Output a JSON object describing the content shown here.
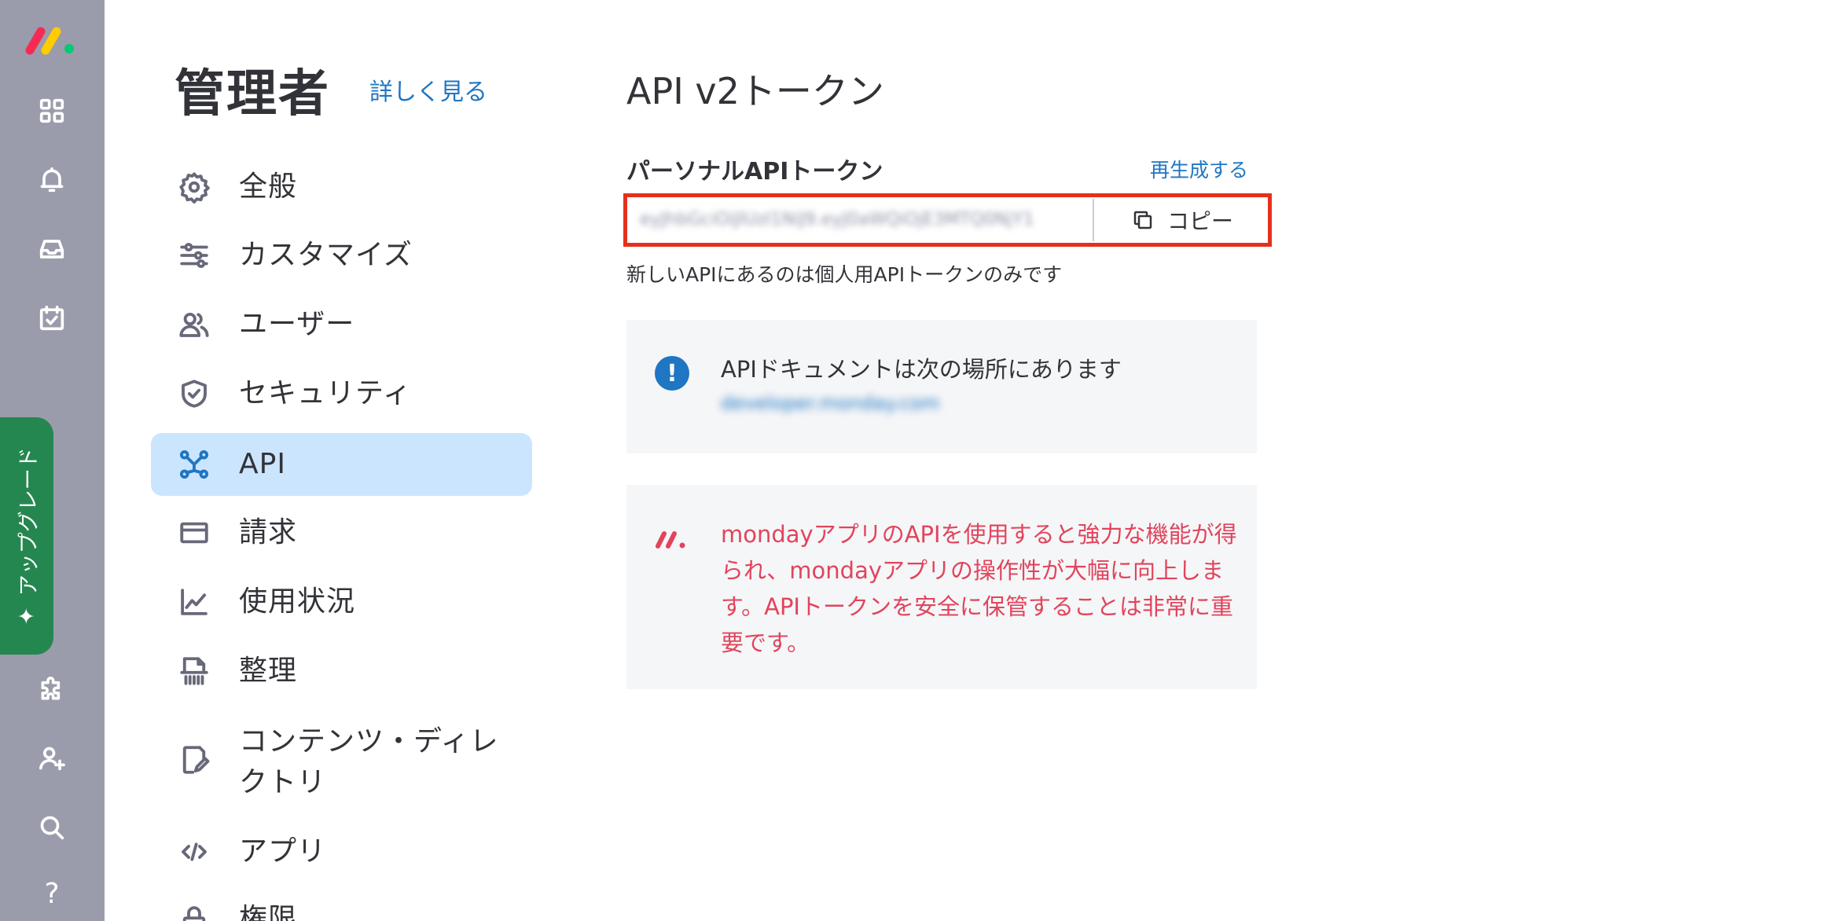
{
  "rail": {
    "upgrade_label": "アップグレード",
    "icons": [
      "apps-icon",
      "bell-icon",
      "inbox-icon",
      "calendar-check-icon",
      "puzzle-icon",
      "invite-user-icon",
      "search-icon",
      "help-icon"
    ],
    "help_label": "?"
  },
  "nav": {
    "title": "管理者",
    "more_link": "詳しく見る",
    "items": [
      {
        "label": "全般",
        "icon": "gear-icon"
      },
      {
        "label": "カスタマイズ",
        "icon": "sliders-icon"
      },
      {
        "label": "ユーザー",
        "icon": "users-icon"
      },
      {
        "label": "セキュリティ",
        "icon": "shield-icon"
      },
      {
        "label": "API",
        "icon": "api-icon",
        "active": true
      },
      {
        "label": "請求",
        "icon": "credit-card-icon"
      },
      {
        "label": "使用状況",
        "icon": "chart-icon"
      },
      {
        "label": "整理",
        "icon": "shredder-icon"
      },
      {
        "label": "コンテンツ・ディレクトリ",
        "icon": "content-directory-icon"
      },
      {
        "label": "アプリ",
        "icon": "code-icon"
      },
      {
        "label": "権限",
        "icon": "lock-icon"
      }
    ]
  },
  "main": {
    "title": "API v2トークン",
    "section_label": "パーソナルAPIトークン",
    "regenerate_link": "再生成する",
    "token_value": "eyJhbGciOiJIUzI1NiJ9.eyJ0aWQiOjE3MTQ0NjY1",
    "copy_label": "コピー",
    "hint": "新しいAPIにあるのは個人用APIトークンのみです",
    "doc_card": {
      "text": "APIドキュメントは次の場所にあります",
      "link": "developer.monday.com"
    },
    "promo_card": {
      "text": "mondayアプリのAPIを使用すると強力な機能が得られ、mondayアプリの操作性が大幅に向上します。APIトークンを安全に保管することは非常に重要です。"
    },
    "colors": {
      "accent": "#1f76c2",
      "active_bg": "#cce5ff",
      "highlight_border": "#e5301b",
      "promo_text": "#e2445c",
      "upgrade_bg": "#258750",
      "rail_bg": "#9a9cab"
    }
  }
}
